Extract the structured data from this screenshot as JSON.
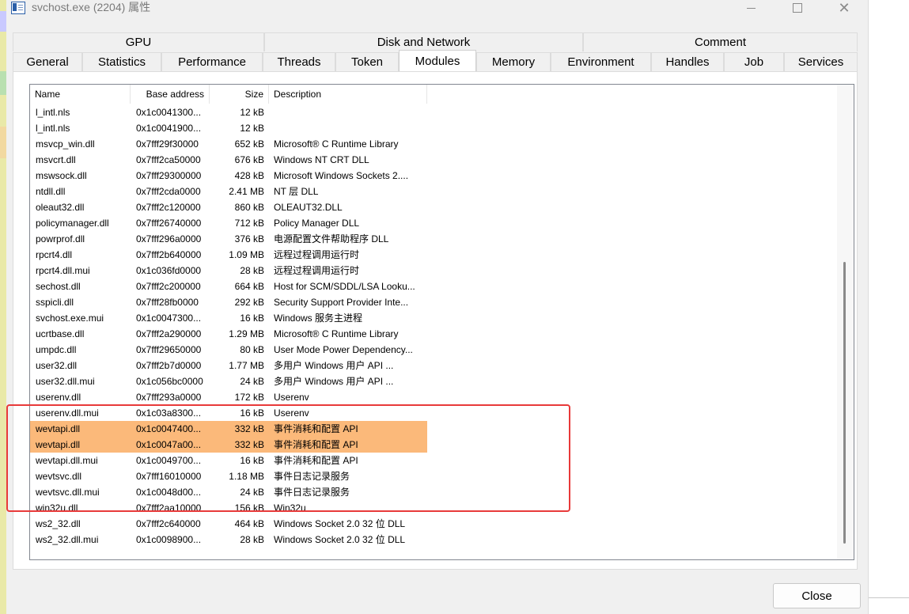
{
  "window": {
    "title": "svchost.exe (2204) 属性",
    "minimize_glyph": "",
    "close_glyph": "✕"
  },
  "tabs_top": [
    {
      "label": "GPU"
    },
    {
      "label": "Disk and Network"
    },
    {
      "label": "Comment"
    }
  ],
  "tabs_bottom": [
    {
      "label": "General"
    },
    {
      "label": "Statistics"
    },
    {
      "label": "Performance"
    },
    {
      "label": "Threads"
    },
    {
      "label": "Token"
    },
    {
      "label": "Modules",
      "active": true
    },
    {
      "label": "Memory"
    },
    {
      "label": "Environment"
    },
    {
      "label": "Handles"
    },
    {
      "label": "Job"
    },
    {
      "label": "Services"
    }
  ],
  "columns": {
    "name": "Name",
    "base": "Base address",
    "size": "Size",
    "desc": "Description"
  },
  "rows": [
    {
      "name": "l_intl.nls",
      "base": "0x1c0041300...",
      "size": "12 kB",
      "desc": ""
    },
    {
      "name": "l_intl.nls",
      "base": "0x1c0041900...",
      "size": "12 kB",
      "desc": ""
    },
    {
      "name": "msvcp_win.dll",
      "base": "0x7fff29f30000",
      "size": "652 kB",
      "desc": "Microsoft® C Runtime Library"
    },
    {
      "name": "msvcrt.dll",
      "base": "0x7fff2ca50000",
      "size": "676 kB",
      "desc": "Windows NT CRT DLL"
    },
    {
      "name": "mswsock.dll",
      "base": "0x7fff29300000",
      "size": "428 kB",
      "desc": "Microsoft Windows Sockets 2...."
    },
    {
      "name": "ntdll.dll",
      "base": "0x7fff2cda0000",
      "size": "2.41 MB",
      "desc": "NT 层 DLL"
    },
    {
      "name": "oleaut32.dll",
      "base": "0x7fff2c120000",
      "size": "860 kB",
      "desc": "OLEAUT32.DLL"
    },
    {
      "name": "policymanager.dll",
      "base": "0x7fff26740000",
      "size": "712 kB",
      "desc": "Policy Manager DLL"
    },
    {
      "name": "powrprof.dll",
      "base": "0x7fff296a0000",
      "size": "376 kB",
      "desc": "电源配置文件帮助程序 DLL"
    },
    {
      "name": "rpcrt4.dll",
      "base": "0x7fff2b640000",
      "size": "1.09 MB",
      "desc": "远程过程调用运行时"
    },
    {
      "name": "rpcrt4.dll.mui",
      "base": "0x1c036fd0000",
      "size": "28 kB",
      "desc": "远程过程调用运行时"
    },
    {
      "name": "sechost.dll",
      "base": "0x7fff2c200000",
      "size": "664 kB",
      "desc": "Host for SCM/SDDL/LSA Looku..."
    },
    {
      "name": "sspicli.dll",
      "base": "0x7fff28fb0000",
      "size": "292 kB",
      "desc": "Security Support Provider Inte..."
    },
    {
      "name": "svchost.exe.mui",
      "base": "0x1c0047300...",
      "size": "16 kB",
      "desc": "Windows 服务主进程"
    },
    {
      "name": "ucrtbase.dll",
      "base": "0x7fff2a290000",
      "size": "1.29 MB",
      "desc": "Microsoft® C Runtime Library"
    },
    {
      "name": "umpdc.dll",
      "base": "0x7fff29650000",
      "size": "80 kB",
      "desc": "User Mode Power Dependency..."
    },
    {
      "name": "user32.dll",
      "base": "0x7fff2b7d0000",
      "size": "1.77 MB",
      "desc": "多用户 Windows 用户 API ..."
    },
    {
      "name": "user32.dll.mui",
      "base": "0x1c056bc0000",
      "size": "24 kB",
      "desc": "多用户 Windows 用户 API ..."
    },
    {
      "name": "userenv.dll",
      "base": "0x7fff293a0000",
      "size": "172 kB",
      "desc": "Userenv"
    },
    {
      "name": "userenv.dll.mui",
      "base": "0x1c03a8300...",
      "size": "16 kB",
      "desc": "Userenv"
    },
    {
      "name": "wevtapi.dll",
      "base": "0x1c0047400...",
      "size": "332 kB",
      "desc": "事件消耗和配置 API",
      "highlighted": true
    },
    {
      "name": "wevtapi.dll",
      "base": "0x1c0047a00...",
      "size": "332 kB",
      "desc": "事件消耗和配置 API",
      "highlighted": true
    },
    {
      "name": "wevtapi.dll.mui",
      "base": "0x1c0049700...",
      "size": "16 kB",
      "desc": "事件消耗和配置 API"
    },
    {
      "name": "wevtsvc.dll",
      "base": "0x7fff16010000",
      "size": "1.18 MB",
      "desc": "事件日志记录服务"
    },
    {
      "name": "wevtsvc.dll.mui",
      "base": "0x1c0048d00...",
      "size": "24 kB",
      "desc": "事件日志记录服务"
    },
    {
      "name": "win32u.dll",
      "base": "0x7fff2aa10000",
      "size": "156 kB",
      "desc": "Win32u"
    },
    {
      "name": "ws2_32.dll",
      "base": "0x7fff2c640000",
      "size": "464 kB",
      "desc": "Windows Socket 2.0 32 位 DLL"
    },
    {
      "name": "ws2_32.dll.mui",
      "base": "0x1c0098900...",
      "size": "28 kB",
      "desc": "Windows Socket 2.0 32 位 DLL"
    }
  ],
  "highlight_color": "#fbb97a",
  "annotation_color": "#e83a3a",
  "footer": {
    "close_label": "Close"
  }
}
